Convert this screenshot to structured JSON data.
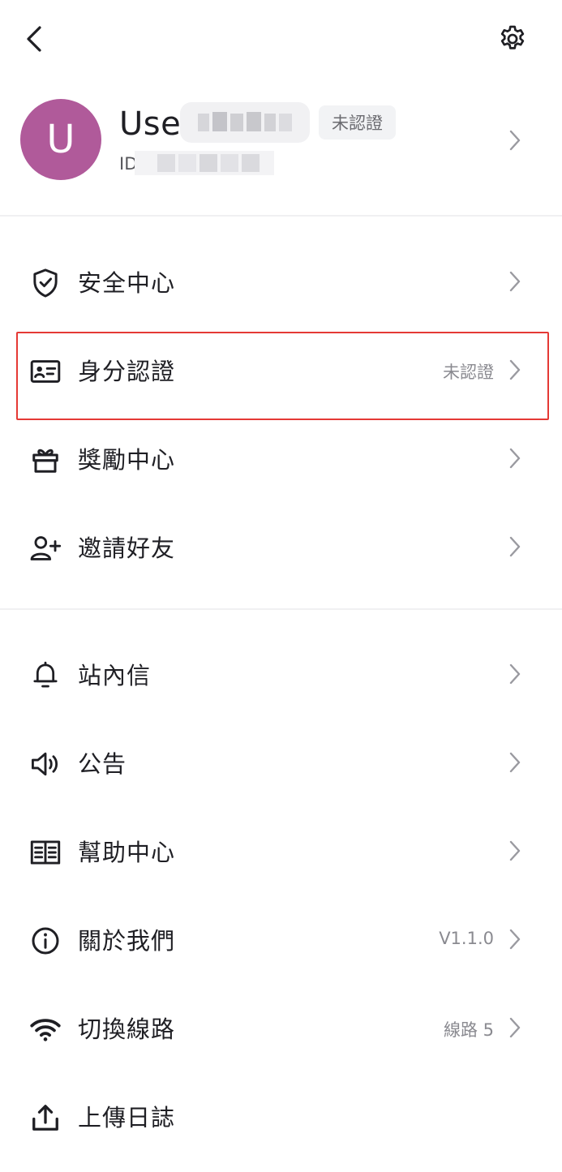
{
  "profile": {
    "avatar_letter": "U",
    "username": "User",
    "badge": "未認證",
    "id_prefix": "ID"
  },
  "menu_group1": [
    {
      "icon": "shield-check-icon",
      "label": "安全中心",
      "value": ""
    },
    {
      "icon": "id-card-icon",
      "label": "身分認證",
      "value": "未認證"
    },
    {
      "icon": "gift-icon",
      "label": "獎勵中心",
      "value": ""
    },
    {
      "icon": "add-user-icon",
      "label": "邀請好友",
      "value": ""
    }
  ],
  "menu_group2": [
    {
      "icon": "bell-icon",
      "label": "站內信",
      "value": ""
    },
    {
      "icon": "speaker-icon",
      "label": "公告",
      "value": ""
    },
    {
      "icon": "book-icon",
      "label": "幫助中心",
      "value": ""
    },
    {
      "icon": "info-icon",
      "label": "關於我們",
      "value": "V1.1.0"
    },
    {
      "icon": "wifi-icon",
      "label": "切換線路",
      "value": "線路 5"
    },
    {
      "icon": "upload-icon",
      "label": "上傳日誌",
      "value": ""
    }
  ],
  "colors": {
    "avatar_bg": "#b05a9a",
    "highlight_border": "#e53935",
    "text_primary": "#1f1f24",
    "text_secondary": "#8a8a90"
  }
}
